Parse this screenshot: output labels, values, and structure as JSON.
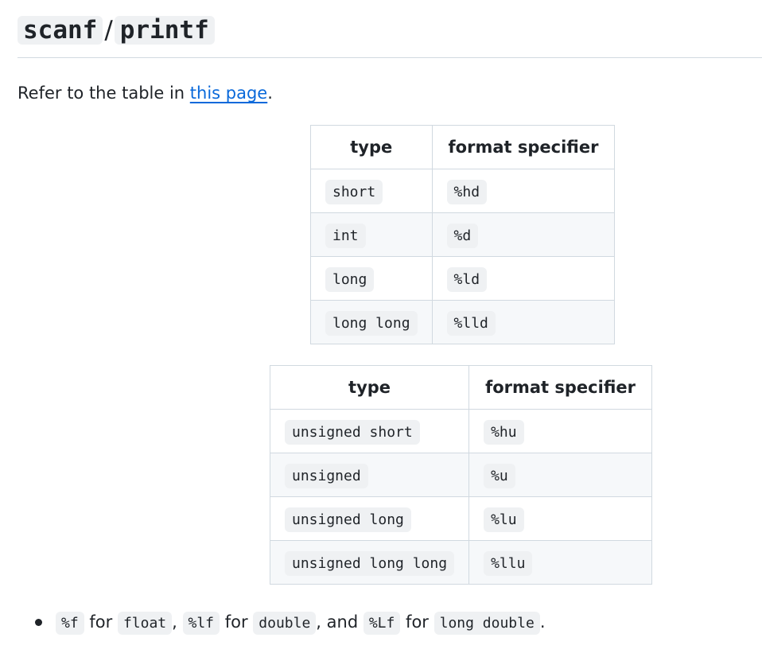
{
  "heading": {
    "part1": "scanf",
    "separator": "/",
    "part2": "printf"
  },
  "intro": {
    "text": "Refer to the table in ",
    "link": "this page",
    "end": "."
  },
  "table1": {
    "headers": [
      "type",
      "format specifier"
    ],
    "rows": [
      [
        "short",
        "%hd"
      ],
      [
        "int",
        "%d"
      ],
      [
        "long",
        "%ld"
      ],
      [
        "long long",
        "%lld"
      ]
    ]
  },
  "table2": {
    "headers": [
      "type",
      "format specifier"
    ],
    "rows": [
      [
        "unsigned short",
        "%hu"
      ],
      [
        "unsigned",
        "%u"
      ],
      [
        "unsigned long",
        "%lu"
      ],
      [
        "unsigned long long",
        "%llu"
      ]
    ]
  },
  "note": {
    "f_spec": "%f",
    "for1": "for",
    "float": "float",
    "comma1": ",",
    "lf_spec": "%lf",
    "for2": "for",
    "double": "double",
    "and": ", and",
    "Lf_spec": "%Lf",
    "for3": "for",
    "long_double": "long double",
    "end": "."
  }
}
